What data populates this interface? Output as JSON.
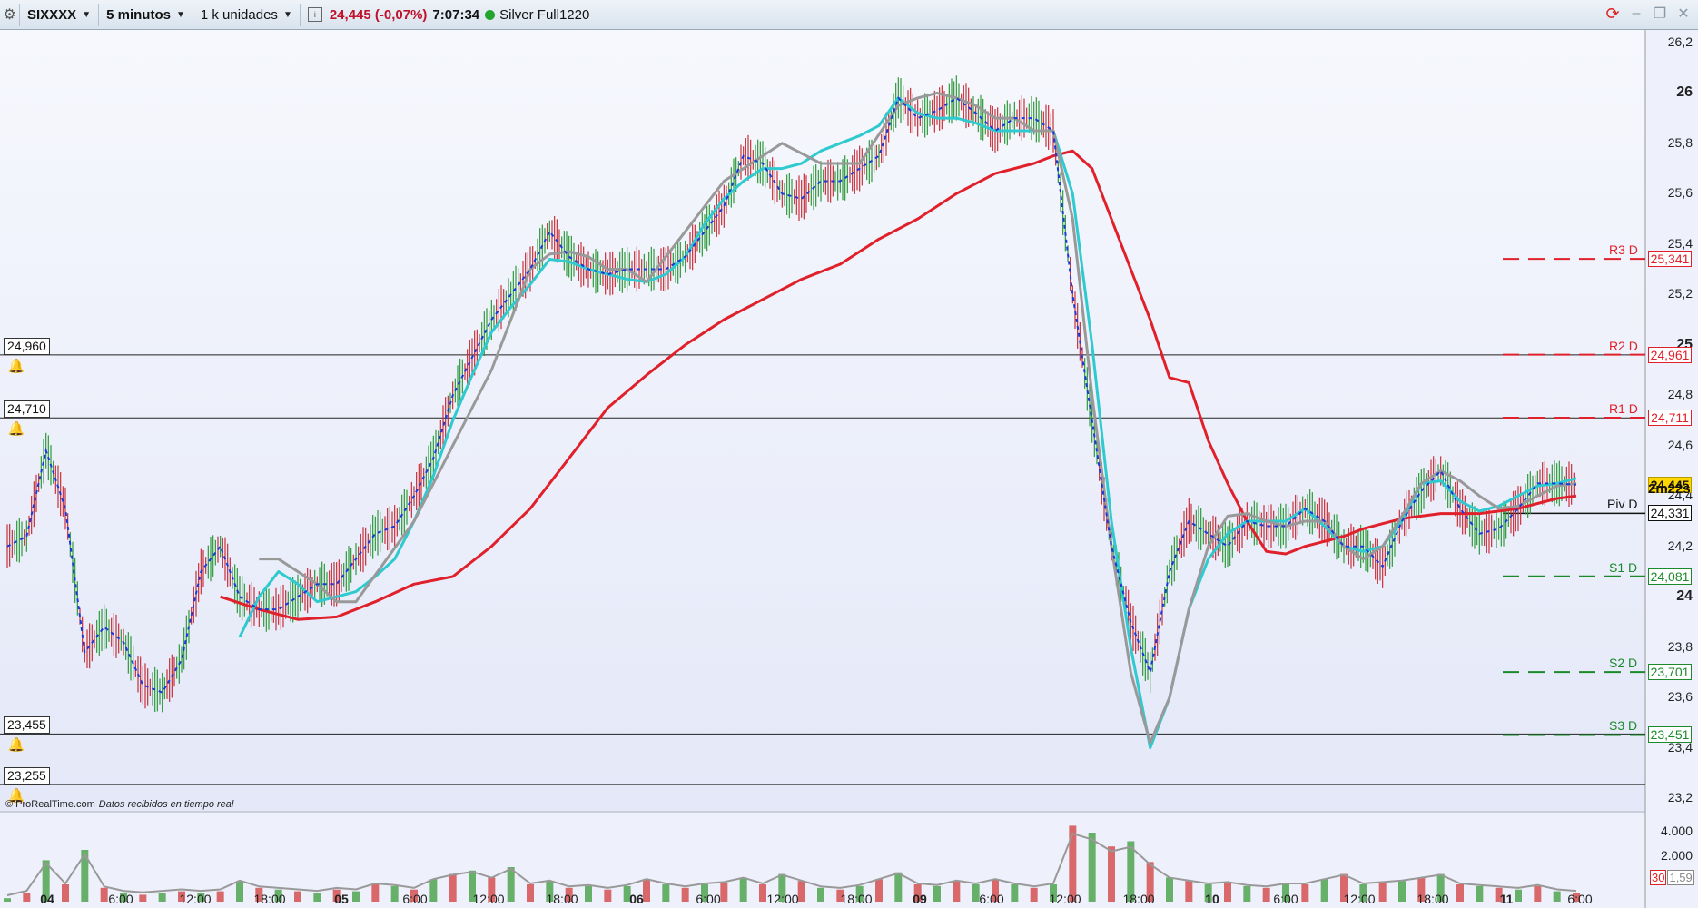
{
  "toolbar": {
    "instrument": "SIXXXX",
    "timeframe": "5 minutos",
    "units": "1 k unidades",
    "price": "24,445 (-0,07%)",
    "time": "7:07:34",
    "feed": "Silver Full1220"
  },
  "copyright": "© ProRealTime.com",
  "realtime_note": "Datos recibidos en tiempo real",
  "countdown": "2m22s",
  "levels": [
    {
      "label": "24,960",
      "value": 24.96
    },
    {
      "label": "24,710",
      "value": 24.71
    },
    {
      "label": "23,455",
      "value": 23.455
    },
    {
      "label": "23,255",
      "value": 23.255
    }
  ],
  "pivots": [
    {
      "name": "R3 D",
      "label": "25,341",
      "value": 25.341,
      "color": "#e0202a"
    },
    {
      "name": "R2 D",
      "label": "24,961",
      "value": 24.961,
      "color": "#e0202a"
    },
    {
      "name": "R1 D",
      "label": "24,711",
      "value": 24.711,
      "color": "#e0202a"
    },
    {
      "name": "Piv D",
      "label": "24,331",
      "value": 24.331,
      "color": "#111111"
    },
    {
      "name": "S1 D",
      "label": "24,081",
      "value": 24.081,
      "color": "#1a8a2a"
    },
    {
      "name": "S2 D",
      "label": "23,701",
      "value": 23.701,
      "color": "#1a8a2a"
    },
    {
      "name": "S3 D",
      "label": "23,451",
      "value": 23.451,
      "color": "#1a8a2a"
    }
  ],
  "last_price_label": "24,445",
  "volume_axis": {
    "ticks": [
      "4.000",
      "2.000"
    ],
    "box": "30",
    "box2": "1,59"
  },
  "chart_data": {
    "type": "line",
    "ylim": [
      23.15,
      26.25
    ],
    "yticks": [
      "26,2",
      "26",
      "25,8",
      "25,6",
      "25,4",
      "25,2",
      "25",
      "24,8",
      "24,6",
      "24,4",
      "24,2",
      "24",
      "23,8",
      "23,6",
      "23,4",
      "23,2"
    ],
    "major_yticks": [
      "26",
      "25",
      "24"
    ],
    "xticks": [
      "04",
      "6:00",
      "12:00",
      "18:00",
      "05",
      "6:00",
      "12:00",
      "18:00",
      "06",
      "6:00",
      "12:00",
      "18:00",
      "09",
      "6:00",
      "12:00",
      "18:00",
      "10",
      "6:00",
      "12:00",
      "18:00",
      "11",
      "6:00"
    ],
    "major_xticks": [
      "04",
      "05",
      "06",
      "09",
      "10",
      "11"
    ],
    "last_price": 24.445,
    "x_range": [
      0,
      84
    ],
    "price": [
      [
        0,
        24.2
      ],
      [
        1,
        24.24
      ],
      [
        2,
        24.58
      ],
      [
        3,
        24.35
      ],
      [
        4,
        23.78
      ],
      [
        5,
        23.88
      ],
      [
        6,
        23.82
      ],
      [
        7,
        23.65
      ],
      [
        8,
        23.62
      ],
      [
        9,
        23.75
      ],
      [
        10,
        24.1
      ],
      [
        11,
        24.2
      ],
      [
        12,
        24.0
      ],
      [
        13,
        23.95
      ],
      [
        14,
        23.95
      ],
      [
        15,
        24.0
      ],
      [
        16,
        24.05
      ],
      [
        17,
        24.05
      ],
      [
        18,
        24.15
      ],
      [
        19,
        24.25
      ],
      [
        20,
        24.28
      ],
      [
        21,
        24.4
      ],
      [
        22,
        24.55
      ],
      [
        23,
        24.8
      ],
      [
        24,
        24.95
      ],
      [
        25,
        25.1
      ],
      [
        26,
        25.2
      ],
      [
        27,
        25.3
      ],
      [
        28,
        25.45
      ],
      [
        29,
        25.35
      ],
      [
        30,
        25.3
      ],
      [
        31,
        25.28
      ],
      [
        32,
        25.3
      ],
      [
        33,
        25.3
      ],
      [
        34,
        25.3
      ],
      [
        35,
        25.35
      ],
      [
        36,
        25.45
      ],
      [
        37,
        25.55
      ],
      [
        38,
        25.75
      ],
      [
        39,
        25.72
      ],
      [
        40,
        25.6
      ],
      [
        41,
        25.58
      ],
      [
        42,
        25.65
      ],
      [
        43,
        25.65
      ],
      [
        44,
        25.7
      ],
      [
        45,
        25.75
      ],
      [
        46,
        25.98
      ],
      [
        47,
        25.9
      ],
      [
        48,
        25.93
      ],
      [
        49,
        25.98
      ],
      [
        50,
        25.92
      ],
      [
        51,
        25.85
      ],
      [
        52,
        25.9
      ],
      [
        53,
        25.9
      ],
      [
        54,
        25.85
      ],
      [
        55,
        25.2
      ],
      [
        56,
        24.7
      ],
      [
        57,
        24.2
      ],
      [
        58,
        23.9
      ],
      [
        59,
        23.7
      ],
      [
        60,
        24.1
      ],
      [
        61,
        24.3
      ],
      [
        62,
        24.25
      ],
      [
        63,
        24.2
      ],
      [
        64,
        24.3
      ],
      [
        65,
        24.28
      ],
      [
        66,
        24.28
      ],
      [
        67,
        24.35
      ],
      [
        68,
        24.3
      ],
      [
        69,
        24.2
      ],
      [
        70,
        24.2
      ],
      [
        71,
        24.12
      ],
      [
        72,
        24.3
      ],
      [
        73,
        24.42
      ],
      [
        74,
        24.5
      ],
      [
        75,
        24.35
      ],
      [
        76,
        24.25
      ],
      [
        77,
        24.27
      ],
      [
        78,
        24.35
      ],
      [
        79,
        24.45
      ],
      [
        80,
        24.45
      ],
      [
        81,
        24.445
      ]
    ],
    "series": [
      {
        "color": "#e0202a",
        "values": [
          [
            11,
            24.0
          ],
          [
            13,
            23.95
          ],
          [
            15,
            23.91
          ],
          [
            17,
            23.92
          ],
          [
            19,
            23.98
          ],
          [
            21,
            24.05
          ],
          [
            23,
            24.08
          ],
          [
            25,
            24.2
          ],
          [
            27,
            24.35
          ],
          [
            29,
            24.55
          ],
          [
            31,
            24.75
          ],
          [
            33,
            24.88
          ],
          [
            35,
            25.0
          ],
          [
            37,
            25.1
          ],
          [
            39,
            25.18
          ],
          [
            41,
            25.26
          ],
          [
            43,
            25.32
          ],
          [
            45,
            25.42
          ],
          [
            47,
            25.5
          ],
          [
            49,
            25.6
          ],
          [
            51,
            25.68
          ],
          [
            53,
            25.72
          ],
          [
            54,
            25.75
          ],
          [
            55,
            25.77
          ],
          [
            56,
            25.7
          ],
          [
            57,
            25.5
          ],
          [
            58,
            25.3
          ],
          [
            59,
            25.1
          ],
          [
            60,
            24.87
          ],
          [
            61,
            24.85
          ],
          [
            62,
            24.62
          ],
          [
            63,
            24.45
          ],
          [
            64,
            24.3
          ],
          [
            65,
            24.18
          ],
          [
            66,
            24.17
          ],
          [
            67,
            24.2
          ],
          [
            68,
            24.22
          ],
          [
            69,
            24.24
          ],
          [
            70,
            24.27
          ],
          [
            71,
            24.29
          ],
          [
            72,
            24.31
          ],
          [
            73,
            24.32
          ],
          [
            74,
            24.33
          ],
          [
            75,
            24.33
          ],
          [
            76,
            24.33
          ],
          [
            77,
            24.34
          ],
          [
            78,
            24.35
          ],
          [
            79,
            24.37
          ],
          [
            80,
            24.39
          ],
          [
            81,
            24.4
          ]
        ]
      },
      {
        "color": "#2ecad0",
        "values": [
          [
            12,
            23.84
          ],
          [
            13,
            24.0
          ],
          [
            14,
            24.1
          ],
          [
            15,
            24.05
          ],
          [
            16,
            23.98
          ],
          [
            17,
            24.0
          ],
          [
            18,
            24.02
          ],
          [
            19,
            24.08
          ],
          [
            20,
            24.15
          ],
          [
            21,
            24.3
          ],
          [
            22,
            24.48
          ],
          [
            23,
            24.7
          ],
          [
            24,
            24.88
          ],
          [
            25,
            25.05
          ],
          [
            26,
            25.15
          ],
          [
            27,
            25.24
          ],
          [
            28,
            25.34
          ],
          [
            29,
            25.33
          ],
          [
            30,
            25.3
          ],
          [
            31,
            25.28
          ],
          [
            32,
            25.26
          ],
          [
            33,
            25.25
          ],
          [
            34,
            25.28
          ],
          [
            35,
            25.35
          ],
          [
            36,
            25.48
          ],
          [
            37,
            25.58
          ],
          [
            38,
            25.65
          ],
          [
            39,
            25.7
          ],
          [
            40,
            25.7
          ],
          [
            41,
            25.72
          ],
          [
            42,
            25.77
          ],
          [
            43,
            25.8
          ],
          [
            44,
            25.83
          ],
          [
            45,
            25.87
          ],
          [
            46,
            25.98
          ],
          [
            47,
            25.92
          ],
          [
            48,
            25.9
          ],
          [
            49,
            25.9
          ],
          [
            50,
            25.88
          ],
          [
            51,
            25.85
          ],
          [
            52,
            25.85
          ],
          [
            53,
            25.85
          ],
          [
            54,
            25.85
          ],
          [
            55,
            25.6
          ],
          [
            56,
            25.0
          ],
          [
            57,
            24.3
          ],
          [
            58,
            23.8
          ],
          [
            59,
            23.4
          ],
          [
            60,
            23.6
          ],
          [
            61,
            23.95
          ],
          [
            62,
            24.15
          ],
          [
            63,
            24.25
          ],
          [
            64,
            24.3
          ],
          [
            65,
            24.3
          ],
          [
            66,
            24.3
          ],
          [
            67,
            24.35
          ],
          [
            68,
            24.28
          ],
          [
            69,
            24.2
          ],
          [
            70,
            24.18
          ],
          [
            71,
            24.2
          ],
          [
            72,
            24.3
          ],
          [
            73,
            24.45
          ],
          [
            74,
            24.46
          ],
          [
            75,
            24.38
          ],
          [
            76,
            24.34
          ],
          [
            77,
            24.36
          ],
          [
            78,
            24.4
          ],
          [
            79,
            24.44
          ],
          [
            80,
            24.45
          ],
          [
            81,
            24.47
          ]
        ]
      },
      {
        "color": "#999999",
        "values": [
          [
            13,
            24.15
          ],
          [
            14,
            24.15
          ],
          [
            15,
            24.1
          ],
          [
            16,
            24.05
          ],
          [
            17,
            23.98
          ],
          [
            18,
            23.98
          ],
          [
            21,
            24.3
          ],
          [
            25,
            24.9
          ],
          [
            27,
            25.3
          ],
          [
            28,
            25.36
          ],
          [
            29,
            25.37
          ],
          [
            30,
            25.35
          ],
          [
            31,
            25.3
          ],
          [
            32,
            25.3
          ],
          [
            33,
            25.25
          ],
          [
            35,
            25.45
          ],
          [
            37,
            25.65
          ],
          [
            38,
            25.7
          ],
          [
            40,
            25.8
          ],
          [
            42,
            25.72
          ],
          [
            44,
            25.72
          ],
          [
            46,
            25.95
          ],
          [
            47,
            25.98
          ],
          [
            48,
            26.0
          ],
          [
            49,
            25.98
          ],
          [
            50,
            25.95
          ],
          [
            51,
            25.9
          ],
          [
            52,
            25.9
          ],
          [
            53,
            25.85
          ],
          [
            54,
            25.85
          ],
          [
            55,
            25.5
          ],
          [
            56,
            24.8
          ],
          [
            57,
            24.2
          ],
          [
            58,
            23.7
          ],
          [
            59,
            23.42
          ],
          [
            60,
            23.6
          ],
          [
            61,
            23.95
          ],
          [
            62,
            24.2
          ],
          [
            63,
            24.32
          ],
          [
            64,
            24.33
          ],
          [
            65,
            24.3
          ],
          [
            66,
            24.28
          ],
          [
            67,
            24.3
          ],
          [
            68,
            24.3
          ],
          [
            69,
            24.2
          ],
          [
            70,
            24.15
          ],
          [
            71,
            24.2
          ],
          [
            72,
            24.32
          ],
          [
            73,
            24.45
          ],
          [
            74,
            24.5
          ],
          [
            75,
            24.46
          ],
          [
            76,
            24.4
          ],
          [
            77,
            24.35
          ],
          [
            78,
            24.36
          ],
          [
            79,
            24.4
          ],
          [
            80,
            24.44
          ],
          [
            81,
            24.45
          ]
        ]
      }
    ],
    "volume": [
      [
        0,
        0.2
      ],
      [
        1,
        0.5
      ],
      [
        2,
        2.4
      ],
      [
        3,
        1.0
      ],
      [
        4,
        3.0
      ],
      [
        5,
        0.8
      ],
      [
        6,
        0.5
      ],
      [
        7,
        0.4
      ],
      [
        8,
        0.5
      ],
      [
        9,
        0.6
      ],
      [
        10,
        0.5
      ],
      [
        11,
        0.6
      ],
      [
        12,
        1.2
      ],
      [
        13,
        0.8
      ],
      [
        14,
        0.7
      ],
      [
        15,
        0.6
      ],
      [
        16,
        0.5
      ],
      [
        17,
        0.7
      ],
      [
        18,
        0.6
      ],
      [
        19,
        1.0
      ],
      [
        20,
        0.9
      ],
      [
        21,
        0.7
      ],
      [
        22,
        1.3
      ],
      [
        23,
        1.6
      ],
      [
        24,
        1.8
      ],
      [
        25,
        1.4
      ],
      [
        26,
        2.0
      ],
      [
        27,
        1.0
      ],
      [
        28,
        1.2
      ],
      [
        29,
        0.8
      ],
      [
        30,
        0.9
      ],
      [
        31,
        0.7
      ],
      [
        32,
        0.9
      ],
      [
        33,
        1.3
      ],
      [
        34,
        1.0
      ],
      [
        35,
        0.8
      ],
      [
        36,
        1.0
      ],
      [
        37,
        1.1
      ],
      [
        38,
        1.4
      ],
      [
        39,
        1.0
      ],
      [
        40,
        1.6
      ],
      [
        41,
        1.2
      ],
      [
        42,
        0.8
      ],
      [
        43,
        0.7
      ],
      [
        44,
        0.9
      ],
      [
        45,
        1.3
      ],
      [
        46,
        1.7
      ],
      [
        47,
        1.0
      ],
      [
        48,
        0.9
      ],
      [
        49,
        1.2
      ],
      [
        50,
        1.0
      ],
      [
        51,
        1.3
      ],
      [
        52,
        1.0
      ],
      [
        53,
        0.8
      ],
      [
        54,
        1.0
      ],
      [
        55,
        4.4
      ],
      [
        56,
        4.0
      ],
      [
        57,
        3.2
      ],
      [
        58,
        3.5
      ],
      [
        59,
        2.3
      ],
      [
        60,
        1.4
      ],
      [
        61,
        1.2
      ],
      [
        62,
        1.0
      ],
      [
        63,
        1.1
      ],
      [
        64,
        0.9
      ],
      [
        65,
        0.8
      ],
      [
        66,
        1.0
      ],
      [
        67,
        1.0
      ],
      [
        68,
        1.3
      ],
      [
        69,
        1.6
      ],
      [
        70,
        1.0
      ],
      [
        71,
        1.1
      ],
      [
        72,
        1.2
      ],
      [
        73,
        1.4
      ],
      [
        74,
        1.6
      ],
      [
        75,
        1.0
      ],
      [
        76,
        0.9
      ],
      [
        77,
        0.8
      ],
      [
        78,
        0.7
      ],
      [
        79,
        0.9
      ],
      [
        80,
        0.6
      ],
      [
        81,
        0.5
      ]
    ],
    "volume_ylim": [
      0,
      5.0
    ]
  }
}
